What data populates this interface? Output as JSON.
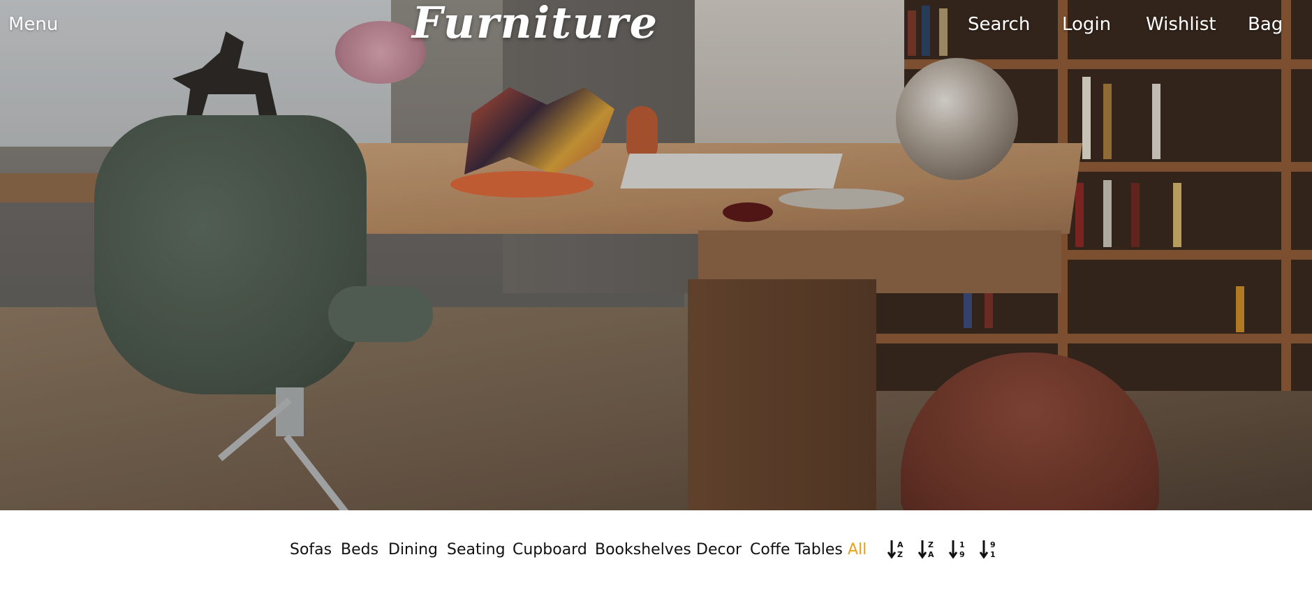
{
  "header": {
    "menu_label": "Menu",
    "logo_text": "Furniture",
    "search_label": "Search",
    "login_label": "Login",
    "wishlist_label": "Wishlist",
    "bag_label": "Bag"
  },
  "categories": [
    {
      "label": "Sofas",
      "active": false
    },
    {
      "label": "Beds",
      "active": false
    },
    {
      "label": "Dining",
      "active": false
    },
    {
      "label": "Seating",
      "active": false
    },
    {
      "label": "Cupboard",
      "active": false
    },
    {
      "label": "Bookshelves",
      "active": false
    },
    {
      "label": "Decor",
      "active": false
    },
    {
      "label": "Coffe Tables",
      "active": false
    },
    {
      "label": "All",
      "active": true
    }
  ],
  "sort_options": [
    {
      "icon": "sort-alpha-asc-icon",
      "top": "A",
      "bottom": "Z"
    },
    {
      "icon": "sort-alpha-desc-icon",
      "top": "Z",
      "bottom": "A"
    },
    {
      "icon": "sort-numeric-asc-icon",
      "top": "1",
      "bottom": "9"
    },
    {
      "icon": "sort-numeric-desc-icon",
      "top": "9",
      "bottom": "1"
    }
  ],
  "colors": {
    "active_category": "#e8a319",
    "category_text": "#111111",
    "nav_text": "#ffffff"
  }
}
